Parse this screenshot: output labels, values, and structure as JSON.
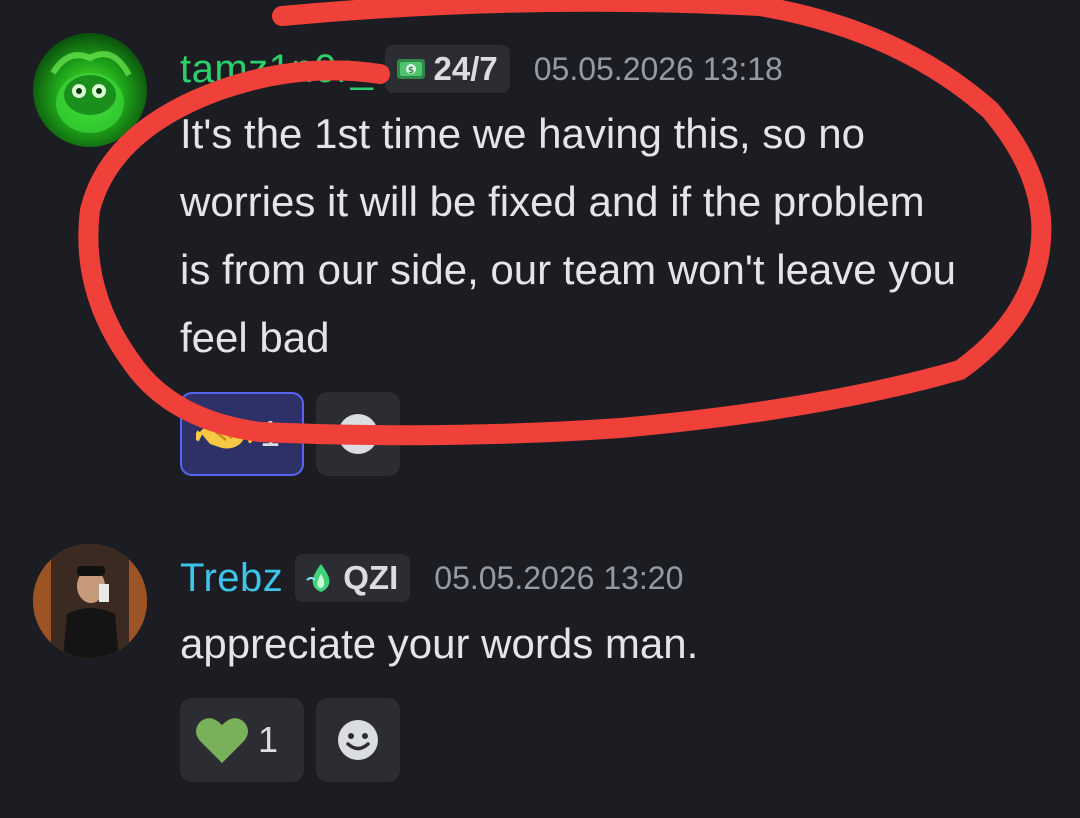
{
  "messages": [
    {
      "username": "tamz1n0r_",
      "tag": {
        "text": "24/7",
        "icon": "money-bill-icon"
      },
      "timestamp": "05.05.2026 13:18",
      "lines": [
        "It's the 1st time we having this, so no",
        "worries it will be fixed and if the problem",
        "is from our side, our team won't leave you",
        "feel bad"
      ],
      "reactions": [
        {
          "emoji": "handshake-emoji",
          "count": "1",
          "me": true
        }
      ]
    },
    {
      "username": "Trebz",
      "tag": {
        "text": "QZI",
        "icon": "green-flame-icon"
      },
      "timestamp": "05.05.2026 13:20",
      "lines": [
        "appreciate your words man."
      ],
      "reactions": [
        {
          "emoji": "green-heart-emoji",
          "count": "1",
          "me": false
        }
      ]
    }
  ],
  "colors": {
    "background": "#1c1d22",
    "username_1": "#2dcf6c",
    "username_2": "#3ec4e8",
    "timestamp": "#949ba4",
    "annotation_stroke": "#f0403a",
    "reaction_selected_border": "#5865f2"
  }
}
